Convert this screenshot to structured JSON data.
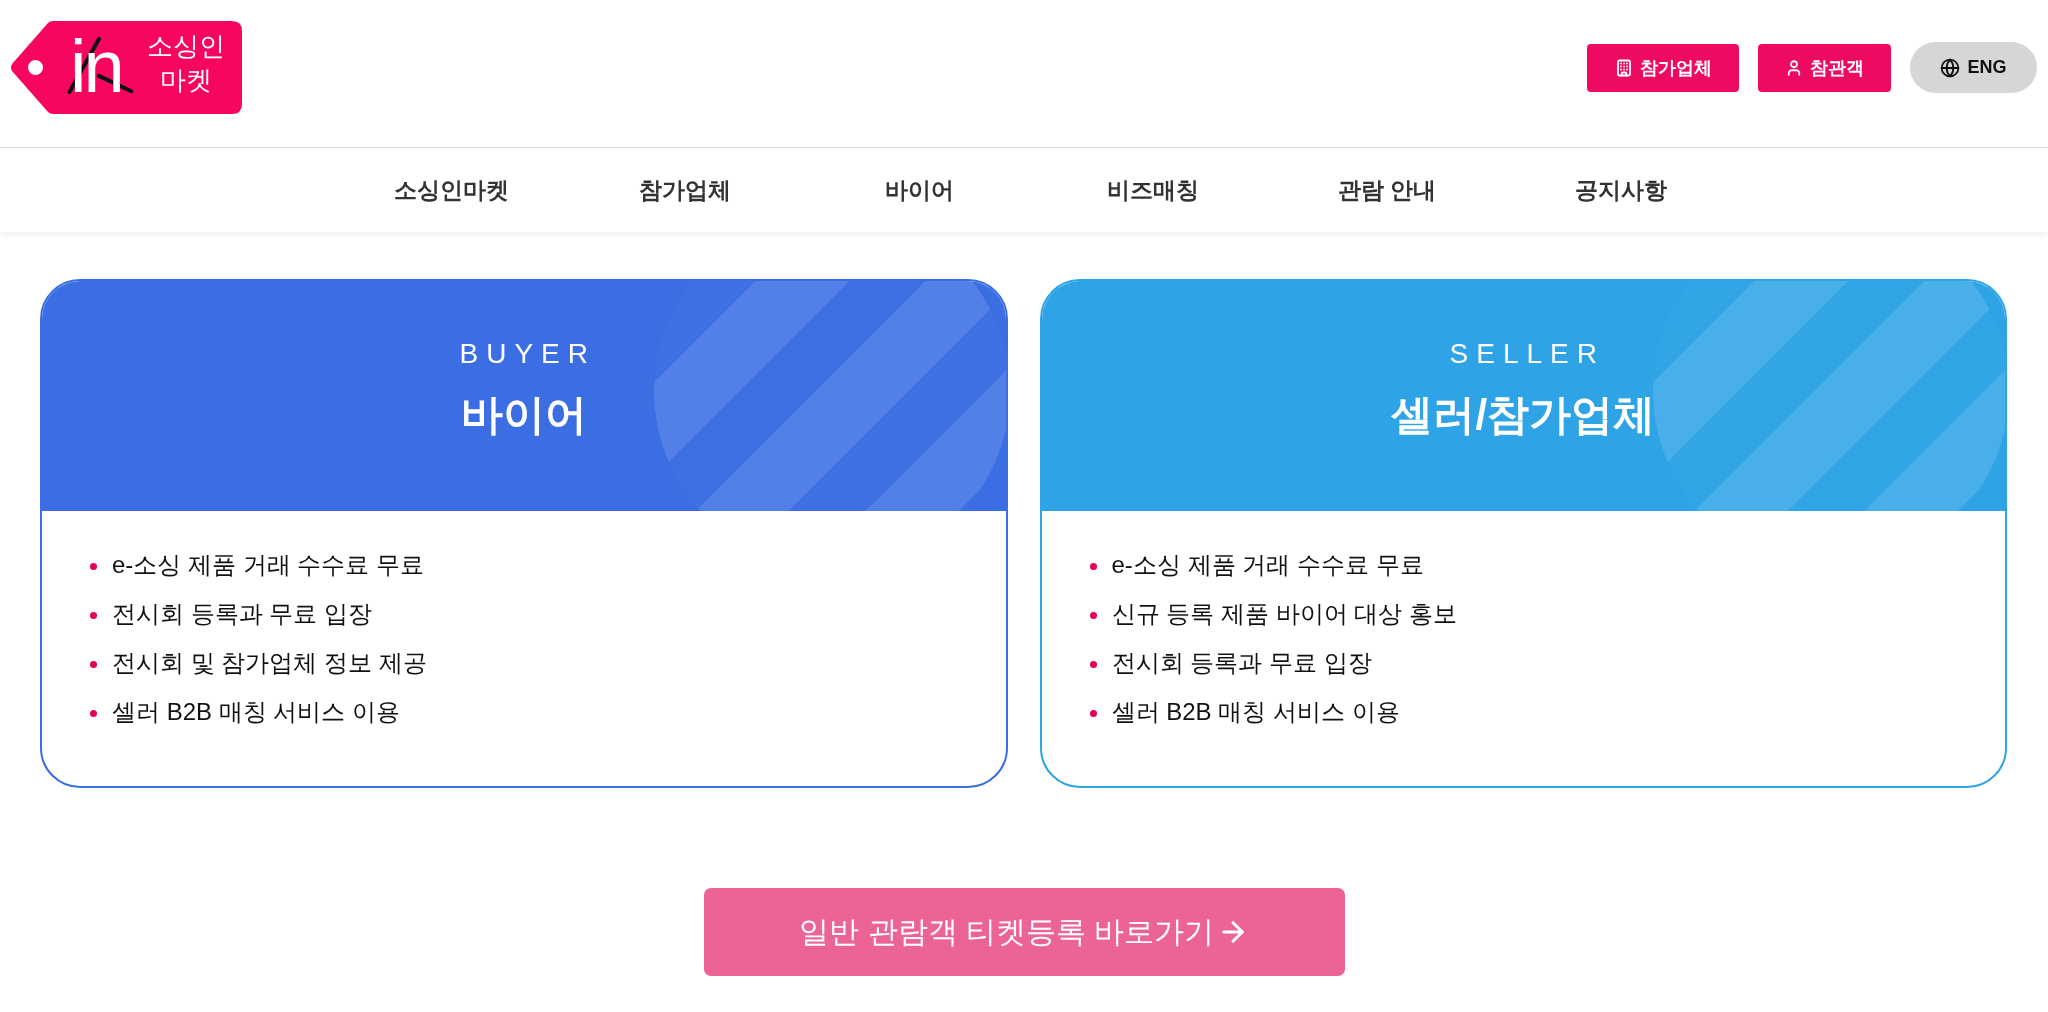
{
  "header": {
    "logo": {
      "mark": "in",
      "name": "소싱인 마켓"
    },
    "actions": [
      {
        "kind": "building",
        "label": "참가업체"
      },
      {
        "kind": "person",
        "label": "참관객"
      },
      {
        "kind": "language",
        "label": "ENG"
      }
    ]
  },
  "nav": {
    "items": [
      {
        "label": "소싱인마켓"
      },
      {
        "label": "참가업체"
      },
      {
        "label": "바이어"
      },
      {
        "label": "비즈매칭"
      },
      {
        "label": "관람 안내"
      },
      {
        "label": "공지사항"
      }
    ]
  },
  "cards": [
    {
      "eyebrow": "BUYER",
      "title": "바이어",
      "color": "#3b6ee3",
      "features": [
        "e-소싱 제품 거래 수수료 무료",
        "전시회 등록과 무료 입장",
        "전시회 및 참가업체 정보 제공",
        "셀러 B2B 매칭 서비스 이용"
      ]
    },
    {
      "eyebrow": "SELLER",
      "title": "셀러/참가업체",
      "color": "#2ea4e6",
      "features": [
        "e-소싱 제품 거래 수수료 무료",
        "신규 등록 제품 바이어 대상 홍보",
        "전시회 등록과 무료 입장",
        "셀러 B2B 매칭 서비스 이용"
      ]
    }
  ],
  "cta": {
    "label": "일반 관람객 티켓등록 바로가기"
  }
}
